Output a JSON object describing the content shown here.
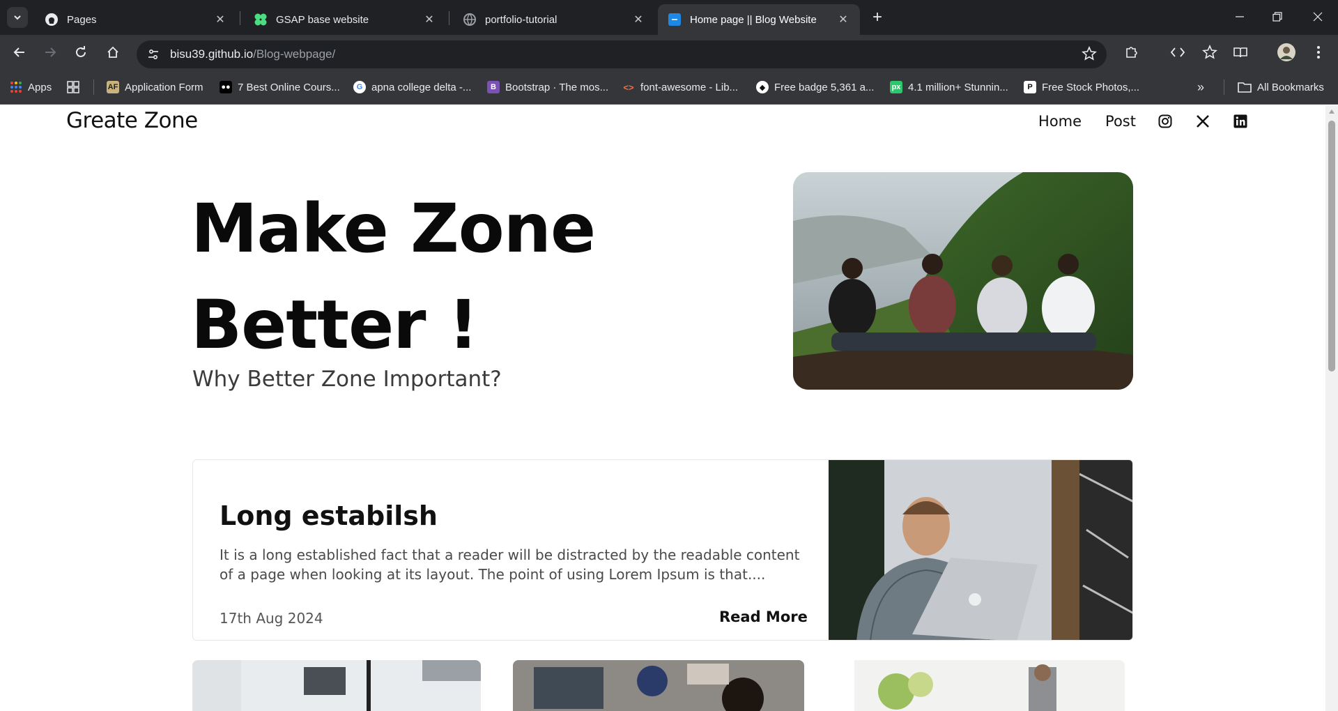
{
  "browser": {
    "tabs": [
      {
        "title": "Pages",
        "icon": "github-icon",
        "active": false
      },
      {
        "title": "GSAP base website",
        "icon": "gsap-clover-icon",
        "active": false
      },
      {
        "title": "portfolio-tutorial",
        "icon": "globe-icon",
        "active": false
      },
      {
        "title": "Home page || Blog Website",
        "icon": "blog-favicon-icon",
        "active": true
      }
    ],
    "url_host": "bisu39.github.io",
    "url_path": "/Blog-webpage/",
    "bookmarks": [
      {
        "label": "Apps",
        "icon": "apps-grid-icon"
      },
      {
        "label": "Application Form",
        "icon": "application-form-icon"
      },
      {
        "label": "7 Best Online Cours...",
        "icon": "medium-icon"
      },
      {
        "label": "apna college delta -...",
        "icon": "google-icon"
      },
      {
        "label": "Bootstrap · The mos...",
        "icon": "bootstrap-icon"
      },
      {
        "label": "font-awesome - Lib...",
        "icon": "code-icon"
      },
      {
        "label": "Free badge 5,361 a...",
        "icon": "badge-icon"
      },
      {
        "label": "4.1 million+ Stunnin...",
        "icon": "pixabay-icon"
      },
      {
        "label": "Free Stock Photos,...",
        "icon": "pexels-icon"
      }
    ],
    "all_bookmarks_label": "All Bookmarks",
    "accent": "#8ab4f8"
  },
  "site": {
    "brand": "Greate Zone",
    "nav": {
      "home": "Home",
      "post": "Post"
    },
    "social_icons": [
      "instagram-icon",
      "x-icon",
      "linkedin-icon"
    ]
  },
  "hero": {
    "title_line1": "Make Zone",
    "title_line2": "Better !",
    "subtitle": "Why Better Zone Important?",
    "image": "friends-on-hill-photo"
  },
  "featured_post": {
    "title": "Long estabilsh",
    "excerpt": "It is a long established fact that a reader will be distracted by the readable content of a page when looking at its layout. The point of using Lorem Ipsum is that....",
    "date": "17th Aug 2024",
    "read_more": "Read More",
    "image": "man-with-laptop-photo"
  },
  "post_grid": [
    {
      "image": "office-desk-photo"
    },
    {
      "image": "team-at-computers-photo"
    },
    {
      "image": "office-people-photo"
    }
  ]
}
